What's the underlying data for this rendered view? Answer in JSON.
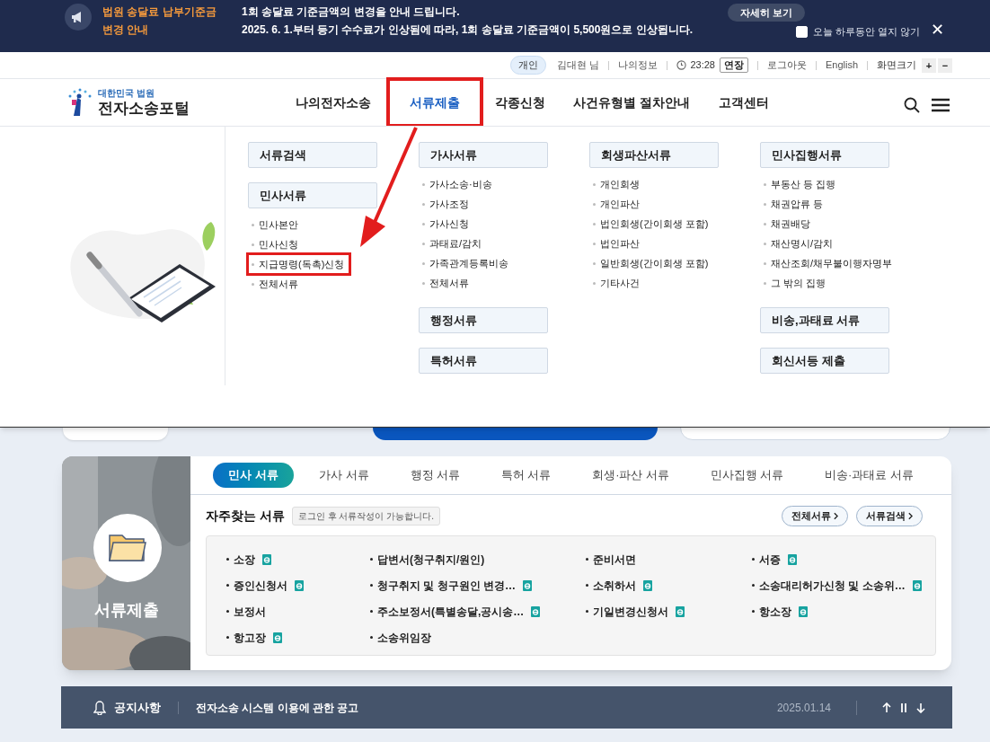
{
  "banner": {
    "title": "법원 송달료 납부기준금\n변경 안내",
    "lines": [
      "1회 송달료 기준금액의 변경을 안내 드립니다.",
      "2025. 6. 1.부터 등기 수수료가 인상됨에 따라, 1회 송달료 기준금액이 5,500원으로 인상됩니다."
    ],
    "detail_button": "자세히 보기",
    "dismiss": {
      "label": "오늘 하루동안 열지 않기",
      "checked": false
    },
    "close": "✕"
  },
  "utility_bar": {
    "user_type": "개인",
    "user_name": "김대현 님",
    "my_info": "나의정보",
    "time": "23:28",
    "extend": "연장",
    "logout": "로그아웃",
    "language": "English",
    "zoom_label": "화면크기",
    "zoom_in": "+",
    "zoom_out": "−"
  },
  "header": {
    "logo_top": "대한민국 법원",
    "logo_main": "전자소송포털",
    "nav": [
      {
        "label": "나의전자소송",
        "selected": false,
        "annotated": false
      },
      {
        "label": "서류제출",
        "selected": true,
        "annotated": true
      },
      {
        "label": "각종신청",
        "selected": false,
        "annotated": false
      },
      {
        "label": "사건유형별 절차안내",
        "selected": false,
        "annotated": false
      },
      {
        "label": "고객센터",
        "selected": false,
        "annotated": false
      }
    ]
  },
  "mega_menu": {
    "columns": [
      [
        {
          "title": "서류검색"
        },
        {
          "title": "민사서류",
          "items": [
            {
              "label": "민사본안",
              "annotated": false
            },
            {
              "label": "민사신청",
              "annotated": false
            },
            {
              "label": "지급명령(독촉)신청",
              "annotated": true
            },
            {
              "label": "전체서류",
              "annotated": false
            }
          ]
        }
      ],
      [
        {
          "title": "가사서류",
          "items": [
            {
              "label": "가사소송·비송",
              "annotated": false
            },
            {
              "label": "가사조정",
              "annotated": false
            },
            {
              "label": "가사신청",
              "annotated": false
            },
            {
              "label": "과태료/감치",
              "annotated": false
            },
            {
              "label": "가족관계등록비송",
              "annotated": false
            },
            {
              "label": "전체서류",
              "annotated": false
            }
          ]
        },
        {
          "title": "행정서류"
        },
        {
          "title": "특허서류"
        }
      ],
      [
        {
          "title": "회생파산서류",
          "items": [
            {
              "label": "개인회생",
              "annotated": false
            },
            {
              "label": "개인파산",
              "annotated": false
            },
            {
              "label": "법인회생(간이회생 포함)",
              "annotated": false
            },
            {
              "label": "법인파산",
              "annotated": false
            },
            {
              "label": "일반회생(간이회생 포함)",
              "annotated": false
            },
            {
              "label": "기타사건",
              "annotated": false
            }
          ]
        }
      ],
      [
        {
          "title": "민사집행서류",
          "items": [
            {
              "label": "부동산 등 집행",
              "annotated": false
            },
            {
              "label": "채권압류 등",
              "annotated": false
            },
            {
              "label": "채권배당",
              "annotated": false
            },
            {
              "label": "재산명시/감치",
              "annotated": false
            },
            {
              "label": "재산조회/채무불이행자명부",
              "annotated": false
            },
            {
              "label": "그 밖의 집행",
              "annotated": false
            }
          ]
        },
        {
          "title": "비송,과태료 서류"
        },
        {
          "title": "회신서등 제출"
        }
      ]
    ]
  },
  "documents_card": {
    "side_label": "서류제출",
    "tabs": [
      {
        "label": "민사 서류",
        "selected": true
      },
      {
        "label": "가사 서류",
        "selected": false
      },
      {
        "label": "행정 서류",
        "selected": false
      },
      {
        "label": "특허 서류",
        "selected": false
      },
      {
        "label": "회생·파산 서류",
        "selected": false
      },
      {
        "label": "민사집행 서류",
        "selected": false
      },
      {
        "label": "비송·과태료 서류",
        "selected": false
      }
    ],
    "heading": "자주찾는 서류",
    "login_note": "로그인 후 서류작성이 가능합니다.",
    "buttons": [
      "전체서류",
      "서류검색"
    ],
    "items": [
      {
        "label": "소장",
        "e_form": true
      },
      {
        "label": "답변서(청구취지/원인)",
        "e_form": false
      },
      {
        "label": "준비서면",
        "e_form": false
      },
      {
        "label": "서증",
        "e_form": true
      },
      {
        "label": "증인신청서",
        "e_form": true
      },
      {
        "label": "청구취지 및 청구원인 변경…",
        "e_form": true
      },
      {
        "label": "소취하서",
        "e_form": true
      },
      {
        "label": "소송대리허가신청 및 소송위…",
        "e_form": true
      },
      {
        "label": "보정서",
        "e_form": false
      },
      {
        "label": "주소보정서(특별송달,공시송…",
        "e_form": true
      },
      {
        "label": "기일변경신청서",
        "e_form": true
      },
      {
        "label": "항소장",
        "e_form": true
      },
      {
        "label": "항고장",
        "e_form": true
      },
      {
        "label": "소송위임장",
        "e_form": false
      }
    ]
  },
  "notice_bar": {
    "label": "공지사항",
    "title": "전자소송 시스템 이용에 관한 공고",
    "date": "2025.01.14"
  }
}
